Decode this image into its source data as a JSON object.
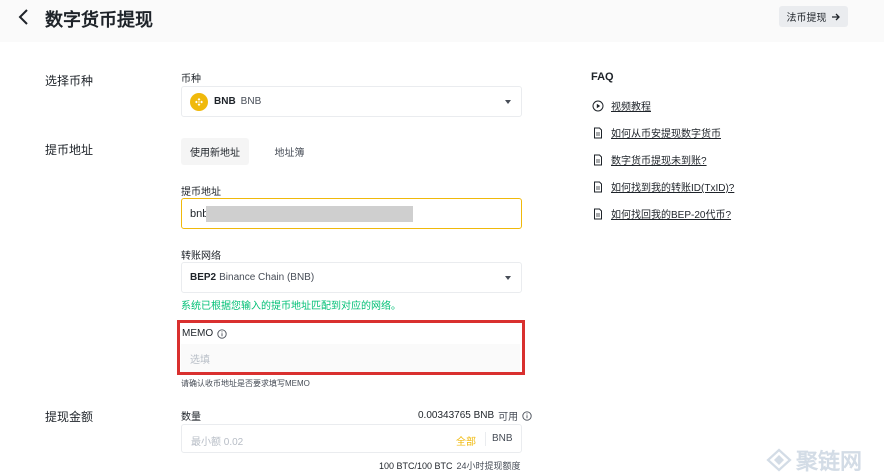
{
  "header": {
    "title": "数字货币提现",
    "fiat_button": "法币提现"
  },
  "sections": {
    "select_coin": "选择币种",
    "address": "提币地址",
    "amount": "提现金额"
  },
  "coin": {
    "label": "币种",
    "symbol": "BNB",
    "name": "BNB",
    "icon": "bnb-coin-icon",
    "icon_color": "#f0b90b"
  },
  "address_tabs": [
    {
      "label": "使用新地址",
      "active": true
    },
    {
      "label": "地址簿",
      "active": false
    }
  ],
  "address_field": {
    "label": "提币地址",
    "value": "bnb"
  },
  "network": {
    "label": "转账网络",
    "name": "BEP2",
    "desc": "Binance Chain (BNB)",
    "hint": "系统已根据您输入的提币地址匹配到对应的网络。",
    "hint_color": "#02c076"
  },
  "memo": {
    "label": "MEMO",
    "placeholder": "选填",
    "hint": "请确认收币地址是否要求填写MEMO",
    "highlight_color": "#d9302f"
  },
  "amount": {
    "label": "数量",
    "balance": "0.00343765 BNB",
    "available": "可用",
    "placeholder": "最小额 0.02",
    "all_label": "全部",
    "unit": "BNB",
    "limit": "100 BTC/100 BTC",
    "limit_label": "24小时提现额度"
  },
  "faq": {
    "title": "FAQ",
    "items": [
      {
        "label": "视频教程",
        "icon": "play-circle-icon"
      },
      {
        "label": "如何从币安提现数字货币",
        "icon": "document-icon"
      },
      {
        "label": "数字货币提现未到账?",
        "icon": "document-icon"
      },
      {
        "label": "如何找到我的转账ID(TxID)?",
        "icon": "document-icon"
      },
      {
        "label": "如何找回我的BEP-20代币?",
        "icon": "document-icon"
      }
    ]
  },
  "watermark": {
    "text": "聚链网",
    "icon": "chain-logo-icon"
  },
  "colors": {
    "accent": "#f0b90b",
    "text": "#1e2329",
    "muted": "#474d57",
    "border": "#eaecef"
  }
}
